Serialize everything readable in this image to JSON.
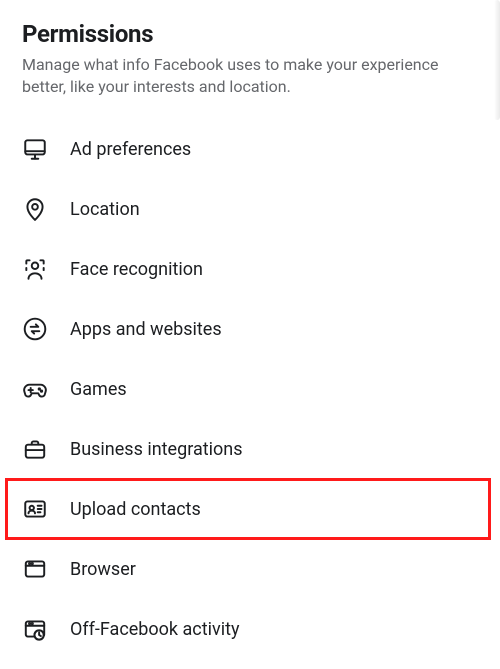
{
  "header": {
    "title": "Permissions",
    "subtitle": "Manage what info Facebook uses to make your experience better, like your interests and location."
  },
  "items": [
    {
      "id": "ad-preferences",
      "label": "Ad preferences",
      "icon": "monitor-icon"
    },
    {
      "id": "location",
      "label": "Location",
      "icon": "location-pin-icon"
    },
    {
      "id": "face-recognition",
      "label": "Face recognition",
      "icon": "face-recognition-icon"
    },
    {
      "id": "apps-websites",
      "label": "Apps and websites",
      "icon": "swap-circle-icon"
    },
    {
      "id": "games",
      "label": "Games",
      "icon": "gamepad-icon"
    },
    {
      "id": "business-integrations",
      "label": "Business integrations",
      "icon": "briefcase-icon"
    },
    {
      "id": "upload-contacts",
      "label": "Upload contacts",
      "icon": "contact-card-icon",
      "highlighted": true
    },
    {
      "id": "browser",
      "label": "Browser",
      "icon": "browser-window-icon"
    },
    {
      "id": "off-facebook-activity",
      "label": "Off-Facebook activity",
      "icon": "activity-clock-icon"
    }
  ]
}
